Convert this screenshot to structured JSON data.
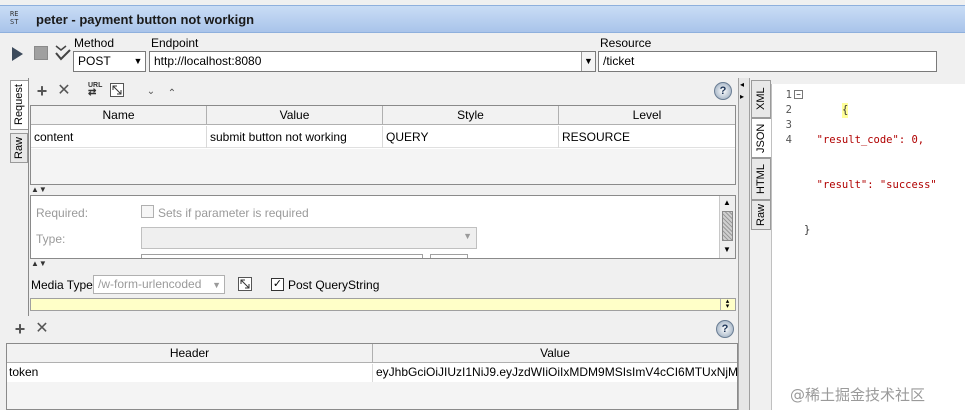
{
  "title": "peter - payment button not workign",
  "title_icon": "RE\nST",
  "toolbar": {
    "method_label": "Method",
    "method_value": "POST",
    "endpoint_label": "Endpoint",
    "endpoint_value": "http://localhost:8080",
    "resource_label": "Resource",
    "resource_value": "/ticket"
  },
  "left_tabs": [
    "Request",
    "Raw"
  ],
  "params": {
    "columns": [
      "Name",
      "Value",
      "Style",
      "Level"
    ],
    "rows": [
      {
        "name": "content",
        "value": "submit button not working",
        "style": "QUERY",
        "level": "RESOURCE"
      }
    ]
  },
  "details": {
    "required_label": "Required:",
    "required_checkbox_label": "Sets if parameter is required",
    "type_label": "Type:"
  },
  "media": {
    "label": "Media Type",
    "value": "/w-form-urlencoded",
    "post_qs_label": "Post QueryString"
  },
  "headers": {
    "columns": [
      "Header",
      "Value"
    ],
    "rows": [
      {
        "header": "token",
        "value": "eyJhbGciOiJIUzI1NiJ9.eyJzdWIiOiIxMDM9MSIsImV4cCI6MTUxNjMz..."
      }
    ]
  },
  "right_tabs": [
    "XML",
    "JSON",
    "HTML",
    "Raw"
  ],
  "response": {
    "line_numbers": [
      "1",
      "2",
      "3",
      "4"
    ],
    "lines": [
      "{",
      "  \"result_code\": 0,",
      "  \"result\": \"success\"",
      "}"
    ]
  },
  "watermark": "@稀土掘金技术社区",
  "colors": {
    "title_bar": "#b9d1f0",
    "hint_bar": "#ffffc8",
    "json_key": "#b00000"
  }
}
